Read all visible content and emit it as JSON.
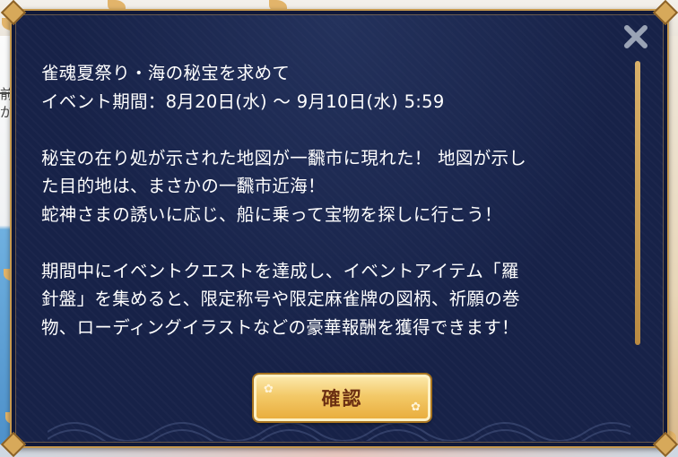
{
  "background": {
    "left_text": [
      "前",
      "が"
    ]
  },
  "notice": {
    "title": "雀魂夏祭り・海の秘宝を求めて",
    "period": "イベント期間：8月20日(水) 〜 9月10日(水) 5:59",
    "para1": [
      "秘宝の在り処が示された地図が一飜市に現れた！ 地図が示し",
      "た目的地は、まさかの一飜市近海！",
      "蛇神さまの誘いに応じ、船に乗って宝物を探しに行こう！"
    ],
    "para2": [
      "期間中にイベントクエストを達成し、イベントアイテム「羅",
      "針盤」を集めると、限定称号や限定麻雀牌の図柄、祈願の巻",
      "物、ローディングイラストなどの豪華報酬を獲得できます！"
    ]
  },
  "buttons": {
    "confirm_label": "確認",
    "close_icon": "close-x-icon"
  },
  "colors": {
    "panel": "#172248",
    "border_gold": "#c79a4f",
    "button_gold": "#f3c968",
    "button_text": "#6b2f12"
  }
}
